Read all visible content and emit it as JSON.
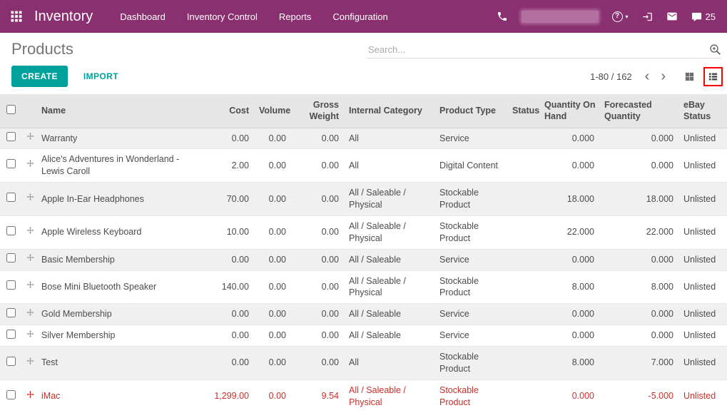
{
  "colors": {
    "topbar": "#8a2f6f",
    "accent": "#00a09d",
    "danger": "#c9302c",
    "annotation": "#ff0000"
  },
  "topbar": {
    "app_title": "Inventory",
    "menu": [
      "Dashboard",
      "Inventory Control",
      "Reports",
      "Configuration"
    ],
    "help_glyph": "?",
    "help_caret": "▾",
    "message_count": "25"
  },
  "page": {
    "title": "Products",
    "search_placeholder": "Search...",
    "create_label": "CREATE",
    "import_label": "IMPORT",
    "pager_text": "1-80 / 162",
    "pager_prev": "‹",
    "pager_next": "›"
  },
  "icons": {
    "apps-grid": "3x3-dot-grid",
    "phone": "handset",
    "help": "question-circle-with-caret",
    "sign-in": "arrow-into-bracket",
    "envelope": "envelope",
    "messages": "speech-bubble-with-count",
    "search": "magnifier-with-plus",
    "kanban-view": "2x2-grid",
    "list-view": "list-rows",
    "drag-handle": "four-way-arrows",
    "pager-prev": "chevron-left",
    "pager-next": "chevron-right"
  },
  "table": {
    "columns": [
      "Name",
      "Cost",
      "Volume",
      "Gross Weight",
      "Internal Category",
      "Product Type",
      "Status",
      "Quantity On Hand",
      "Forecasted Quantity",
      "eBay Status"
    ],
    "rows": [
      {
        "name": "Warranty",
        "cost": "0.00",
        "volume": "0.00",
        "gross_weight": "0.00",
        "category": "All",
        "type": "Service",
        "status": "",
        "qty_on_hand": "0.000",
        "forecasted": "0.000",
        "ebay": "Unlisted",
        "danger": false
      },
      {
        "name": "Alice's Adventures in Wonderland - Lewis Caroll",
        "cost": "2.00",
        "volume": "0.00",
        "gross_weight": "0.00",
        "category": "All",
        "type": "Digital Content",
        "status": "",
        "qty_on_hand": "0.000",
        "forecasted": "0.000",
        "ebay": "Unlisted",
        "danger": false
      },
      {
        "name": "Apple In-Ear Headphones",
        "cost": "70.00",
        "volume": "0.00",
        "gross_weight": "0.00",
        "category": "All / Saleable / Physical",
        "type": "Stockable Product",
        "status": "",
        "qty_on_hand": "18.000",
        "forecasted": "18.000",
        "ebay": "Unlisted",
        "danger": false
      },
      {
        "name": "Apple Wireless Keyboard",
        "cost": "10.00",
        "volume": "0.00",
        "gross_weight": "0.00",
        "category": "All / Saleable / Physical",
        "type": "Stockable Product",
        "status": "",
        "qty_on_hand": "22.000",
        "forecasted": "22.000",
        "ebay": "Unlisted",
        "danger": false
      },
      {
        "name": "Basic Membership",
        "cost": "0.00",
        "volume": "0.00",
        "gross_weight": "0.00",
        "category": "All / Saleable",
        "type": "Service",
        "status": "",
        "qty_on_hand": "0.000",
        "forecasted": "0.000",
        "ebay": "Unlisted",
        "danger": false
      },
      {
        "name": "Bose Mini Bluetooth Speaker",
        "cost": "140.00",
        "volume": "0.00",
        "gross_weight": "0.00",
        "category": "All / Saleable / Physical",
        "type": "Stockable Product",
        "status": "",
        "qty_on_hand": "8.000",
        "forecasted": "8.000",
        "ebay": "Unlisted",
        "danger": false
      },
      {
        "name": "Gold Membership",
        "cost": "0.00",
        "volume": "0.00",
        "gross_weight": "0.00",
        "category": "All / Saleable",
        "type": "Service",
        "status": "",
        "qty_on_hand": "0.000",
        "forecasted": "0.000",
        "ebay": "Unlisted",
        "danger": false
      },
      {
        "name": "Silver Membership",
        "cost": "0.00",
        "volume": "0.00",
        "gross_weight": "0.00",
        "category": "All / Saleable",
        "type": "Service",
        "status": "",
        "qty_on_hand": "0.000",
        "forecasted": "0.000",
        "ebay": "Unlisted",
        "danger": false
      },
      {
        "name": "Test",
        "cost": "0.00",
        "volume": "0.00",
        "gross_weight": "0.00",
        "category": "All",
        "type": "Stockable Product",
        "status": "",
        "qty_on_hand": "8.000",
        "forecasted": "7.000",
        "ebay": "Unlisted",
        "danger": false
      },
      {
        "name": "iMac",
        "cost": "1,299.00",
        "volume": "0.00",
        "gross_weight": "9.54",
        "category": "All / Saleable / Physical",
        "type": "Stockable Product",
        "status": "",
        "qty_on_hand": "0.000",
        "forecasted": "-5.000",
        "ebay": "Unlisted",
        "danger": true
      }
    ]
  }
}
